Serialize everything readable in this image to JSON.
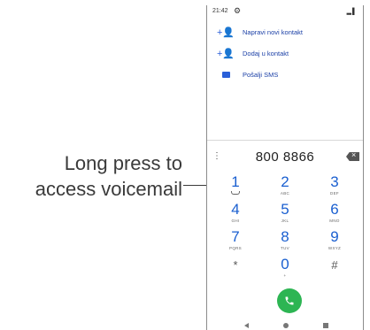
{
  "callout": {
    "line1": "Long press to",
    "line2": "access voicemail"
  },
  "statusbar": {
    "time": "21:42"
  },
  "menu": [
    {
      "label": "Napravi novi kontakt",
      "icon": "add-contact-icon"
    },
    {
      "label": "Dodaj u kontakt",
      "icon": "add-contact-icon"
    },
    {
      "label": "Pošalji SMS",
      "icon": "sms-icon"
    }
  ],
  "dialer": {
    "number": "800 8866",
    "keys": [
      {
        "digit": "1",
        "letters": ""
      },
      {
        "digit": "2",
        "letters": "ABC"
      },
      {
        "digit": "3",
        "letters": "DEF"
      },
      {
        "digit": "4",
        "letters": "GHI"
      },
      {
        "digit": "5",
        "letters": "JKL"
      },
      {
        "digit": "6",
        "letters": "MNO"
      },
      {
        "digit": "7",
        "letters": "PQRS"
      },
      {
        "digit": "8",
        "letters": "TUV"
      },
      {
        "digit": "9",
        "letters": "WXYZ"
      },
      {
        "digit": "*",
        "letters": ""
      },
      {
        "digit": "0",
        "letters": "+"
      },
      {
        "digit": "#",
        "letters": ""
      }
    ]
  },
  "colors": {
    "accent": "#1a5fd0",
    "call": "#2db553"
  }
}
